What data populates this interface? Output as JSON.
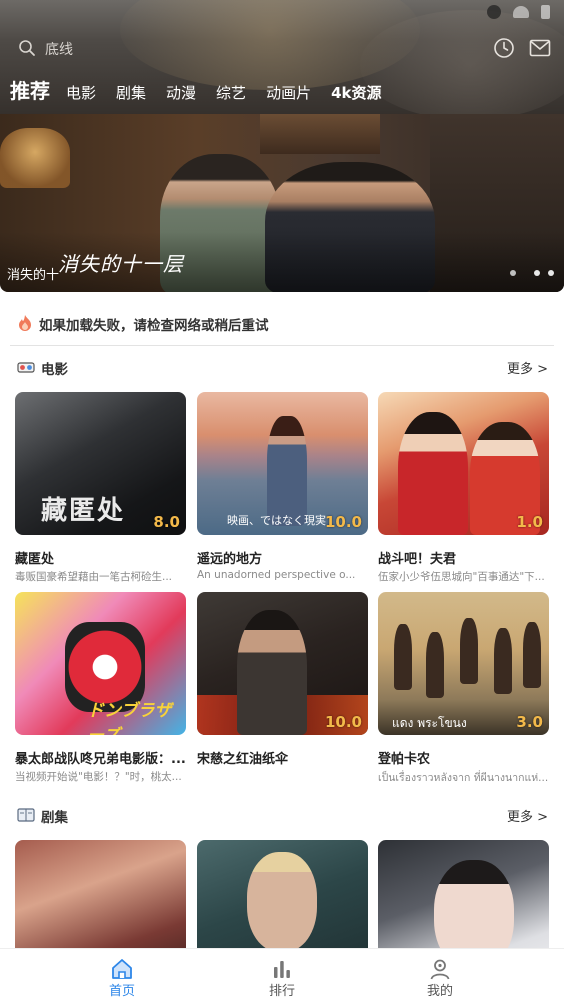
{
  "header": {
    "search_placeholder": "底线",
    "tabs": [
      {
        "label": "推荐",
        "active": true
      },
      {
        "label": "电影"
      },
      {
        "label": "剧集"
      },
      {
        "label": "动漫"
      },
      {
        "label": "综艺"
      },
      {
        "label": "动画片"
      },
      {
        "label": "4k资源"
      }
    ]
  },
  "banner": {
    "title": "消失的十",
    "logo_text": "消失的十一层",
    "dots_count": 3,
    "active_dot": 0
  },
  "notice": {
    "text": "如果加载失败，请检查网络或稍后重试"
  },
  "sections": [
    {
      "title": "电影",
      "more": "更多 >",
      "items": [
        {
          "title": "藏匿处",
          "desc": "毒贩国豪希望藉由一笔古柯硷生...",
          "score": "8.0",
          "poster_text": "藏匿处"
        },
        {
          "title": "遥远的地方",
          "desc": "An unadorned perspective o...",
          "score": "10.0",
          "poster_text": "映画、ではなく現実"
        },
        {
          "title": "战斗吧！夫君",
          "desc": "伍家小少爷伍思城向\"百事通达\"下...",
          "score": "1.0",
          "poster_text": ""
        },
        {
          "title": "暴太郎战队咚兄弟电影版：...",
          "desc": "当视频开始说\"电影！？\"时，桃太...",
          "score": "",
          "poster_text": "ドンブラザーズ"
        },
        {
          "title": "宋慈之红油纸伞",
          "desc": "",
          "score": "10.0",
          "poster_text": ""
        },
        {
          "title": "登帕卡农",
          "desc": "เป็นเรื่องราวหลังจาก ที่ผีนางนากแห่...",
          "score": "3.0",
          "poster_text": "แดง พระโขนง"
        }
      ]
    },
    {
      "title": "剧集",
      "more": "更多 >",
      "items": [
        {
          "title": "",
          "desc": "",
          "score": ""
        },
        {
          "title": "",
          "desc": "",
          "score": ""
        },
        {
          "title": "",
          "desc": "",
          "score": ""
        }
      ]
    }
  ],
  "bottom_nav": [
    {
      "label": "首页",
      "icon": "home-icon",
      "active": true
    },
    {
      "label": "排行",
      "icon": "ranking-icon"
    },
    {
      "label": "我的",
      "icon": "profile-icon"
    }
  ],
  "colors": {
    "accent": "#2d86e8",
    "score": "#f3b94a"
  }
}
